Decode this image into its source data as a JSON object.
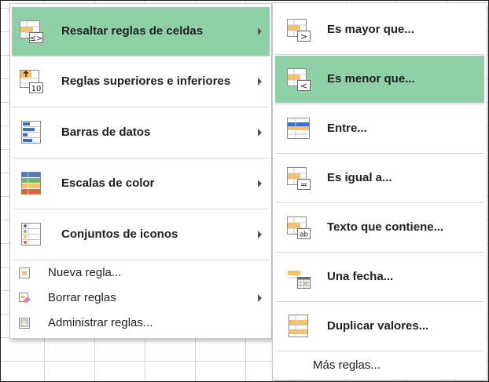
{
  "main_menu": {
    "items": [
      {
        "label": "Resaltar reglas de celdas",
        "icon": "highlight-cells-rules-icon",
        "active": true
      },
      {
        "label": "Reglas superiores e inferiores",
        "icon": "top-bottom-rules-icon"
      },
      {
        "label": "Barras de datos",
        "icon": "data-bars-icon"
      },
      {
        "label": "Escalas de color",
        "icon": "color-scales-icon"
      },
      {
        "label": "Conjuntos de iconos",
        "icon": "icon-sets-icon"
      }
    ],
    "small_items": [
      {
        "label": "Nueva regla...",
        "icon": "new-rule-icon"
      },
      {
        "label": "Borrar reglas",
        "icon": "clear-rules-icon"
      },
      {
        "label": "Administrar reglas...",
        "icon": "manage-rules-icon"
      }
    ]
  },
  "submenu": {
    "items": [
      {
        "label": "Es mayor que...",
        "icon": "greater-than-icon",
        "symbol": ">"
      },
      {
        "label": "Es menor que...",
        "icon": "less-than-icon",
        "symbol": "<",
        "active": true
      },
      {
        "label": "Entre...",
        "icon": "between-icon"
      },
      {
        "label": "Es igual a...",
        "icon": "equal-to-icon",
        "symbol": "="
      },
      {
        "label": "Texto que contiene...",
        "icon": "text-contains-icon",
        "symbol": "ab"
      },
      {
        "label": "Una fecha...",
        "icon": "date-occurring-icon"
      },
      {
        "label": "Duplicar valores...",
        "icon": "duplicate-values-icon"
      }
    ],
    "more_rules": "Más reglas..."
  },
  "icon_badges": {
    "top_bottom": "10"
  },
  "colors": {
    "highlight": "#8fd0a6",
    "accent_fill": "#f5c26b",
    "blue": "#3b6fc4",
    "border": "#c6c6c6"
  }
}
